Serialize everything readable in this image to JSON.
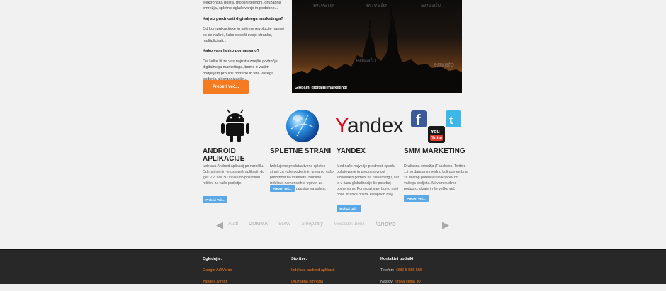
{
  "intro": {
    "p0": "elektronska pošta, mobilni telefoni, družabna omrežja, spletno oglaševanje in podobno...",
    "h1": "Kaj so prednosti digitalnega marketinga?",
    "p1": "Od komunikacijske in spletne revolucije naprej so se načini, kako doseči svoje stranke, multiplicirali...",
    "h2": "Kako vam lahko pomagamo?",
    "p2": "Če želite iti za vas najustreznejše področje digitalnega marketinga, bomo z vašim podjetjem proučili potrebe in vire vašega podjetja ali organizacije...",
    "button": "Preberi več..."
  },
  "slider": {
    "watermark": "envato",
    "caption": "Globalni digitalni marketing!"
  },
  "services": [
    {
      "title": "ANDROID APLIKACIJE",
      "text": "Izdelava Android aplikacij po naročilu. Od majhnih in enostavnih aplikacij, do iger v 2D ali 3D in vse do poslovnih rešitev za vaše podjetje.",
      "button": "Preberi Več..."
    },
    {
      "title": "SPLETNE STRANI",
      "text": "Izdelujemo predstavitvene spletne strani za vaše podjetje in urejamo vašo prisotnost na internetu. Nudimo izdelavo namenskih e-trgovin za prodajo vaših produktov na spletu.",
      "button": "Preberi Več..."
    },
    {
      "title": "YANDEX",
      "icon_text": "Yandex",
      "text": "Med naše največje prednosti spada oglaševanje in prepoznavnost slovenskih podjetij na ruskem trgu, kar je v času globalizacije še posebej pomembno. Pomagali vam bomo najti nove stranke onkraj evropskih mej!",
      "button": "Preberi Več..."
    },
    {
      "title": "SMM MARKETING",
      "icon_text": "You Tube",
      "text": "Družabna omrežja (Facebook, Twitter, ...) so dandanes vedno bolj pomembna za dostop potencialnih kupcev do vašega podjetja. Mi vam nudimo podporo, dizajn in še veliko več",
      "button": "Preberi Več..."
    }
  ],
  "logos": [
    "Audi",
    "DOMMA",
    "BMW",
    "Sleepitaly",
    "Mercedes-Benz",
    "lenovo"
  ],
  "footer": {
    "col1": {
      "heading": "Ogledujte:",
      "items": [
        "Google AdWords",
        "Yandex.Direct"
      ]
    },
    "col2": {
      "heading": "Storitve:",
      "items": [
        "Izdelava android aplikacij",
        "Družabna omrežja"
      ]
    },
    "col3": {
      "heading": "Kontaktni podatki:",
      "phone_label": "Telefon:",
      "phone": "+386 5 555 555",
      "address_label": "Naslov:",
      "address": "Ilirska cesta 30"
    }
  },
  "colors": {
    "accent": "#f47b20",
    "button_blue": "#5aa9e6",
    "footer_bg": "#282828"
  }
}
